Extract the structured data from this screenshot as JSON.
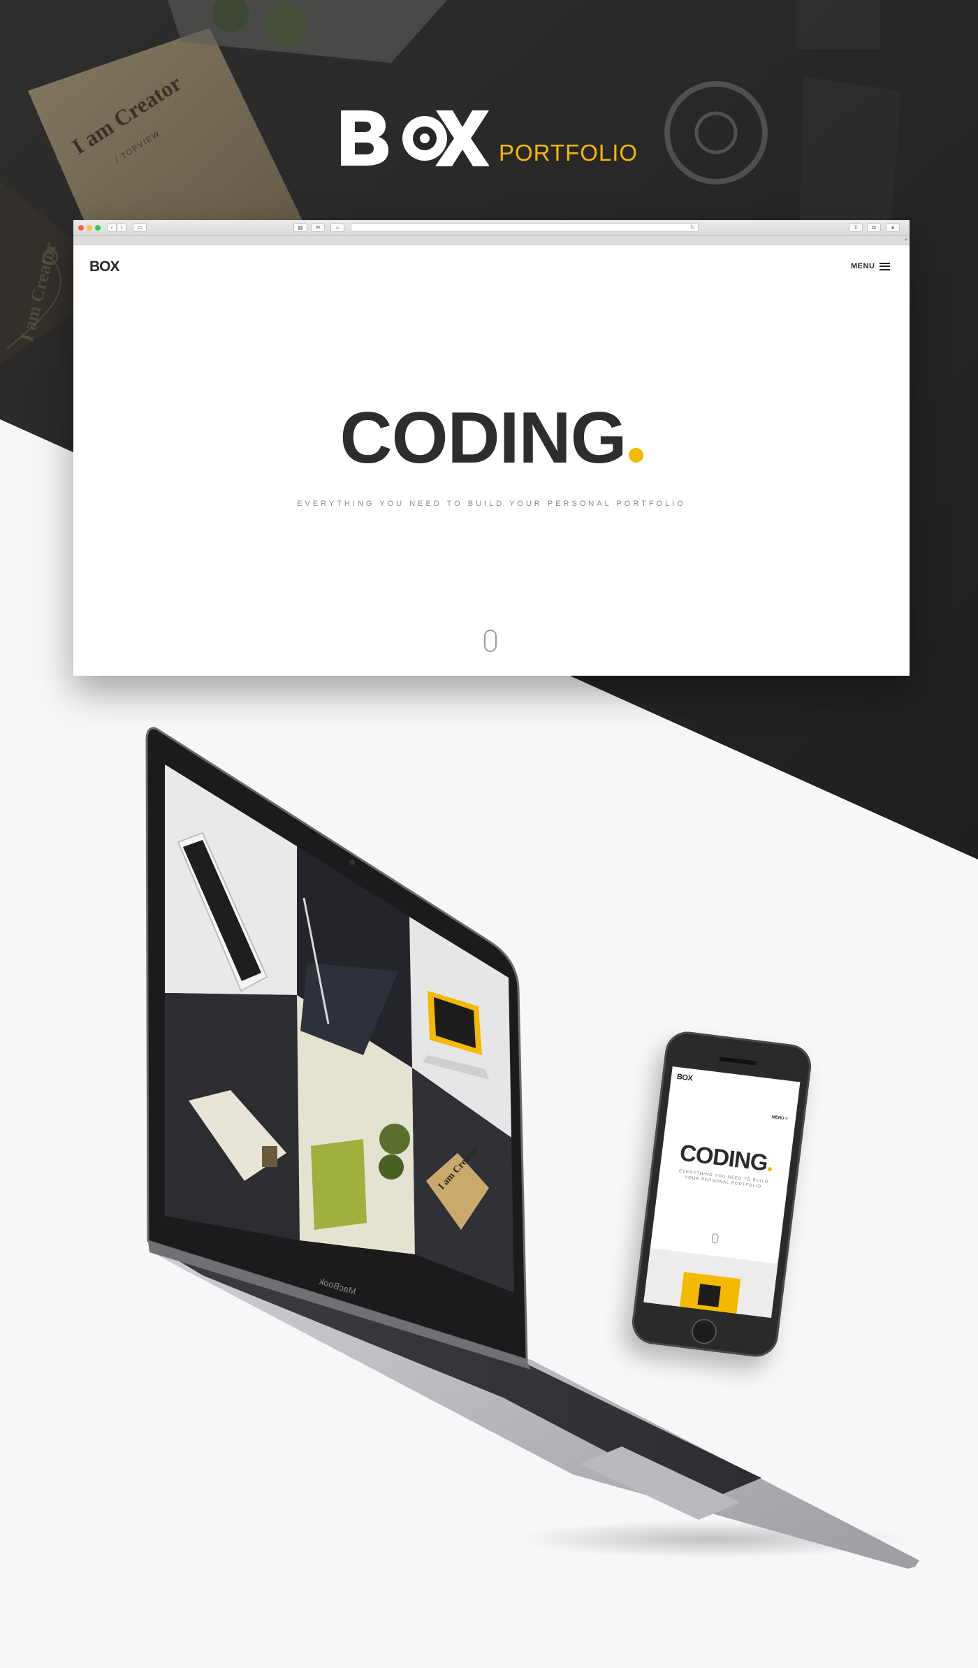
{
  "hero": {
    "brand": "BOX",
    "subtitle": "PORTFOLIO",
    "photo_text": {
      "headline": "I am Creator",
      "byline": "/ TOPVIEW"
    }
  },
  "browser": {
    "site_logo": "BOX",
    "menu_label": "MENU",
    "headline": "CODING",
    "tagline": "EVERYTHING YOU NEED TO BUILD YOUR PERSONAL PORTFOLIO",
    "new_tab": "+"
  },
  "laptop": {
    "brand_label": "MacBook",
    "grid_tiles": [
      "phone-mockup",
      "tablet-pencil",
      "yellow-laptop",
      "desk-objects",
      "plant-cards",
      "creator-envelope"
    ],
    "envelope_text": "I am Creator"
  },
  "phone": {
    "site_logo": "BOX",
    "menu_label": "MENU",
    "headline": "CODING",
    "tagline": "EVERYTHING YOU NEED TO BUILD YOUR PERSONAL PORTFOLIO"
  },
  "colors": {
    "accent": "#f5b900",
    "dark": "#262626",
    "light": "#f7f7f7",
    "text": "#2d2d2d"
  }
}
